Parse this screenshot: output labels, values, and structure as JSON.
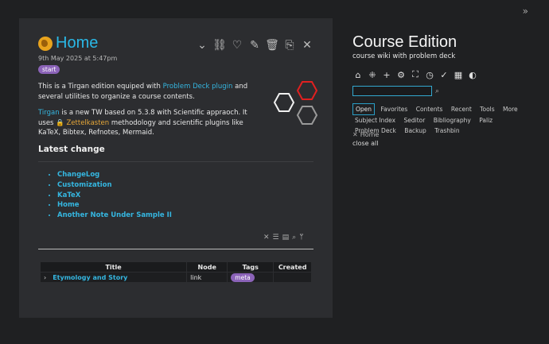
{
  "story": {
    "title": "Home",
    "date": "9th May 2025 at 5:47pm",
    "tag": "start",
    "para1": {
      "t1": "This is a Tirgan edition equiped with ",
      "link": "Problem Deck plugin",
      "t2": " and several utilities to organize a course contents."
    },
    "para2": {
      "link1": "Tirgan",
      "t1": " is a new TW based on 5.3.8 with Scientific appraoch. It uses ",
      "link2": "Zettelkasten",
      "t2": " methodology and scientific plugins like KaTeX, Bibtex, Refnotes, Mermaid."
    },
    "latest_heading": "Latest change",
    "changes": [
      "ChangeLog",
      "Customization",
      "KaTeX",
      "Home",
      "Another Note Under Sample II"
    ],
    "table": {
      "headers": [
        "Title",
        "Node",
        "Tags",
        "Created"
      ],
      "row": {
        "expander": "›",
        "title": "Etymology and Story",
        "node": "link",
        "tag": "meta",
        "created": ""
      }
    }
  },
  "sidebar": {
    "title": "Course Edition",
    "subtitle": "course wiki with problem deck",
    "search_value": "",
    "tabs": [
      "Open",
      "Favorites",
      "Contents",
      "Recent",
      "Tools",
      "More",
      "Subject Index",
      "Seditor",
      "Bibliography",
      "Paliz",
      "Problem Deck",
      "Backup",
      "Trashbin"
    ],
    "open_list": [
      "Home"
    ],
    "close_all": "close all"
  },
  "icons": {
    "toolbar": [
      "chevron-down-icon",
      "link-icon",
      "heart-icon",
      "edit-icon",
      "trash-icon",
      "export-icon",
      "close-icon"
    ],
    "sidebar": [
      "home-icon",
      "layout-icon",
      "plus-icon",
      "gear-icon",
      "fullscreen-icon",
      "stopwatch-icon",
      "check-icon",
      "grid-icon",
      "contrast-icon"
    ]
  },
  "colors": {
    "accent": "#2ab8e6",
    "tag": "#8b63b8",
    "orange": "#e8a838"
  }
}
